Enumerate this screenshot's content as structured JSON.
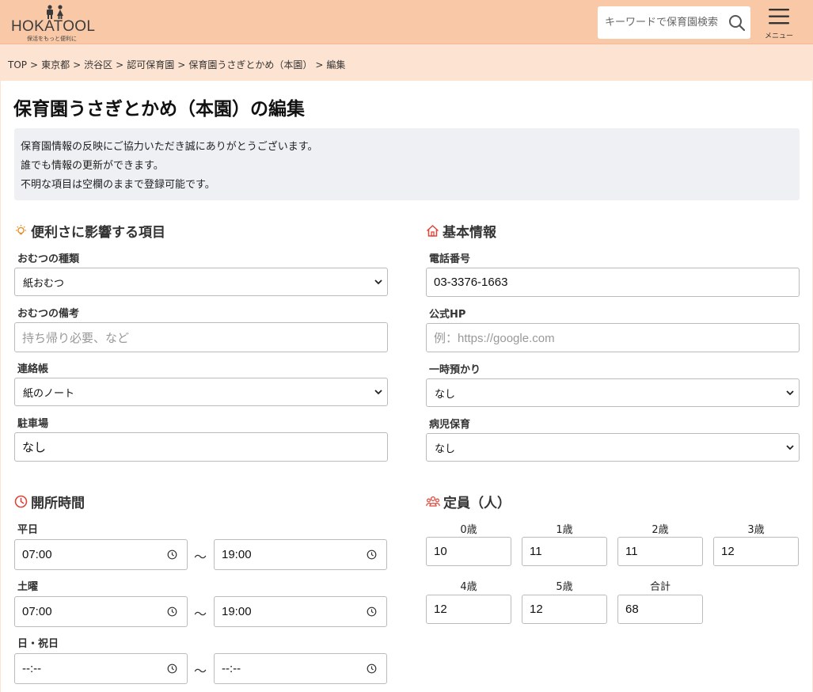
{
  "header": {
    "logo_text": "HOKATOOL",
    "logo_sub": "保活をもっと便利に",
    "search_placeholder": "キーワードで保育園検索",
    "menu_label": "メニュー"
  },
  "breadcrumb": [
    "TOP",
    "東京都",
    "渋谷区",
    "認可保育園",
    "保育園うさぎとかめ（本園）",
    "編集"
  ],
  "page_title": "保育園うさぎとかめ（本園）の編集",
  "notice": [
    "保育園情報の反映にご協力いただき誠にありがとうございます。",
    "誰でも情報の更新ができます。",
    "不明な項目は空欄のままで登録可能です。"
  ],
  "convenience": {
    "title": "便利さに影響する項目",
    "diaper_type_label": "おむつの種類",
    "diaper_type_value": "紙おむつ",
    "diaper_note_label": "おむつの備考",
    "diaper_note_placeholder": "持ち帰り必要、など",
    "notebook_label": "連絡帳",
    "notebook_value": "紙のノート",
    "parking_label": "駐車場",
    "parking_value": "なし"
  },
  "basic": {
    "title": "基本情報",
    "phone_label": "電話番号",
    "phone_value": "03-3376-1663",
    "hp_label": "公式HP",
    "hp_placeholder": "例：https://google.com",
    "temp_care_label": "一時預かり",
    "temp_care_value": "なし",
    "sick_care_label": "病児保育",
    "sick_care_value": "なし"
  },
  "hours": {
    "title": "開所時間",
    "separator": "〜",
    "weekday_label": "平日",
    "weekday_start": "07:00",
    "weekday_end": "19:00",
    "saturday_label": "土曜",
    "saturday_start": "07:00",
    "saturday_end": "19:00",
    "holiday_label": "日・祝日",
    "holiday_start": "--:--",
    "holiday_end": "--:--"
  },
  "capacity": {
    "title": "定員（人）",
    "items": [
      {
        "label": "0歳",
        "value": "10"
      },
      {
        "label": "1歳",
        "value": "11"
      },
      {
        "label": "2歳",
        "value": "11"
      },
      {
        "label": "3歳",
        "value": "12"
      },
      {
        "label": "4歳",
        "value": "12"
      },
      {
        "label": "5歳",
        "value": "12"
      },
      {
        "label": "合計",
        "value": "68"
      }
    ]
  },
  "colors": {
    "header_bg": "#f9c8a6",
    "page_bg": "#fde3d1",
    "accent_icon": "#e0453a",
    "lightbulb_icon": "#e8902a"
  },
  "icons": [
    "logo-icon",
    "search-icon",
    "menu-icon",
    "lightbulb-icon",
    "home-icon",
    "clock-icon",
    "people-icon",
    "chevron-down-icon"
  ]
}
